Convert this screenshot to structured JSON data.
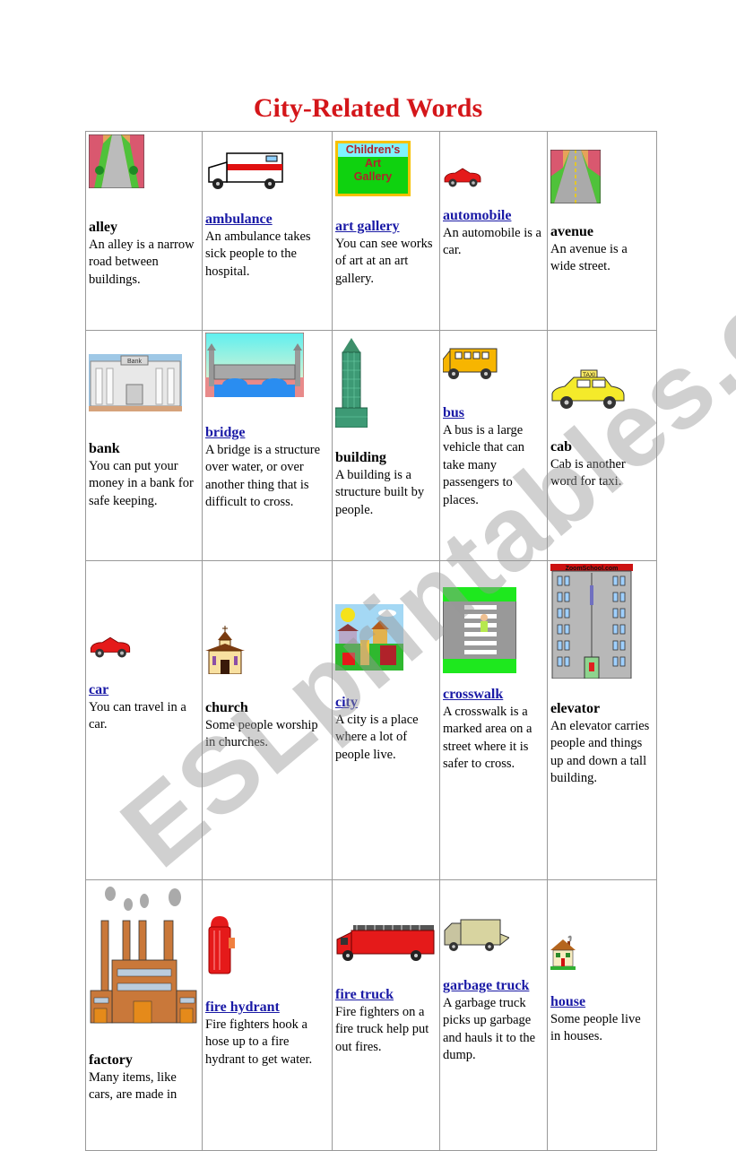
{
  "title": "City-Related Words",
  "watermark": "ESLprintables.com",
  "colors": {
    "title": "#d4161a",
    "link": "#1a1aa6",
    "border": "#999999"
  },
  "rows": [
    [
      {
        "word": "alley",
        "link": false,
        "definition": "An alley is a narrow road between buildings.",
        "icon": "alley-street-picture"
      },
      {
        "word": "ambulance",
        "link": true,
        "definition": "An ambulance takes sick people to the hospital.",
        "icon": "ambulance-picture"
      },
      {
        "word": "art gallery",
        "link": true,
        "definition": "You can see works of art at an art gallery.",
        "icon": "art-gallery-sign-picture",
        "sign_lines": [
          "Children's",
          "Art",
          "Gallery"
        ]
      },
      {
        "word": "automobile",
        "link": true,
        "definition": "An automobile is a car.",
        "icon": "red-car-picture"
      },
      {
        "word": "avenue",
        "link": false,
        "definition": "An avenue is a wide street.",
        "icon": "avenue-picture"
      }
    ],
    [
      {
        "word": "bank",
        "link": false,
        "definition": "You can put your money in a bank for safe keeping.",
        "icon": "bank-building-picture",
        "sign": "Bank"
      },
      {
        "word": "bridge",
        "link": true,
        "definition": "A bridge is a structure over water, or over another thing that is difficult to cross.",
        "icon": "bridge-picture"
      },
      {
        "word": "building",
        "link": false,
        "definition": "A building is a structure built by people.",
        "icon": "skyscraper-picture"
      },
      {
        "word": "bus",
        "link": true,
        "definition": "A bus is a large vehicle that can take many passengers to places.",
        "icon": "school-bus-picture"
      },
      {
        "word": "cab",
        "link": false,
        "definition": "Cab is another word for taxi.",
        "icon": "taxi-picture",
        "sign": "TAXI"
      }
    ],
    [
      {
        "word": "car",
        "link": true,
        "definition": "You can travel in a car.",
        "icon": "red-car-picture"
      },
      {
        "word": "church",
        "link": false,
        "definition": "Some people worship in churches.",
        "icon": "church-picture"
      },
      {
        "word": "city",
        "link": true,
        "definition": "A city is a place where a lot of people live.",
        "icon": "city-scene-picture"
      },
      {
        "word": "crosswalk",
        "link": true,
        "definition": "A crosswalk is a marked area on a street where it is safer to cross.",
        "icon": "crosswalk-picture"
      },
      {
        "word": "elevator",
        "link": false,
        "definition": "An elevator carries people and things up and down a tall building.",
        "icon": "elevator-building-picture",
        "sign": "ZoomSchool.com"
      }
    ],
    [
      {
        "word": "factory",
        "link": false,
        "definition": "Many items, like cars, are made in",
        "icon": "factory-picture"
      },
      {
        "word": "fire hydrant",
        "link": true,
        "definition": "Fire fighters hook a hose up to a fire hydrant to get water.",
        "icon": "fire-hydrant-picture"
      },
      {
        "word": "fire truck",
        "link": true,
        "definition": "Fire fighters on a fire truck help put out fires.",
        "icon": "fire-truck-picture"
      },
      {
        "word": "garbage truck",
        "link": true,
        "definition": "A garbage truck picks up garbage and hauls it to the dump.",
        "icon": "garbage-truck-picture"
      },
      {
        "word": "house",
        "link": true,
        "definition": "Some people live in houses.",
        "icon": "house-picture"
      }
    ]
  ]
}
